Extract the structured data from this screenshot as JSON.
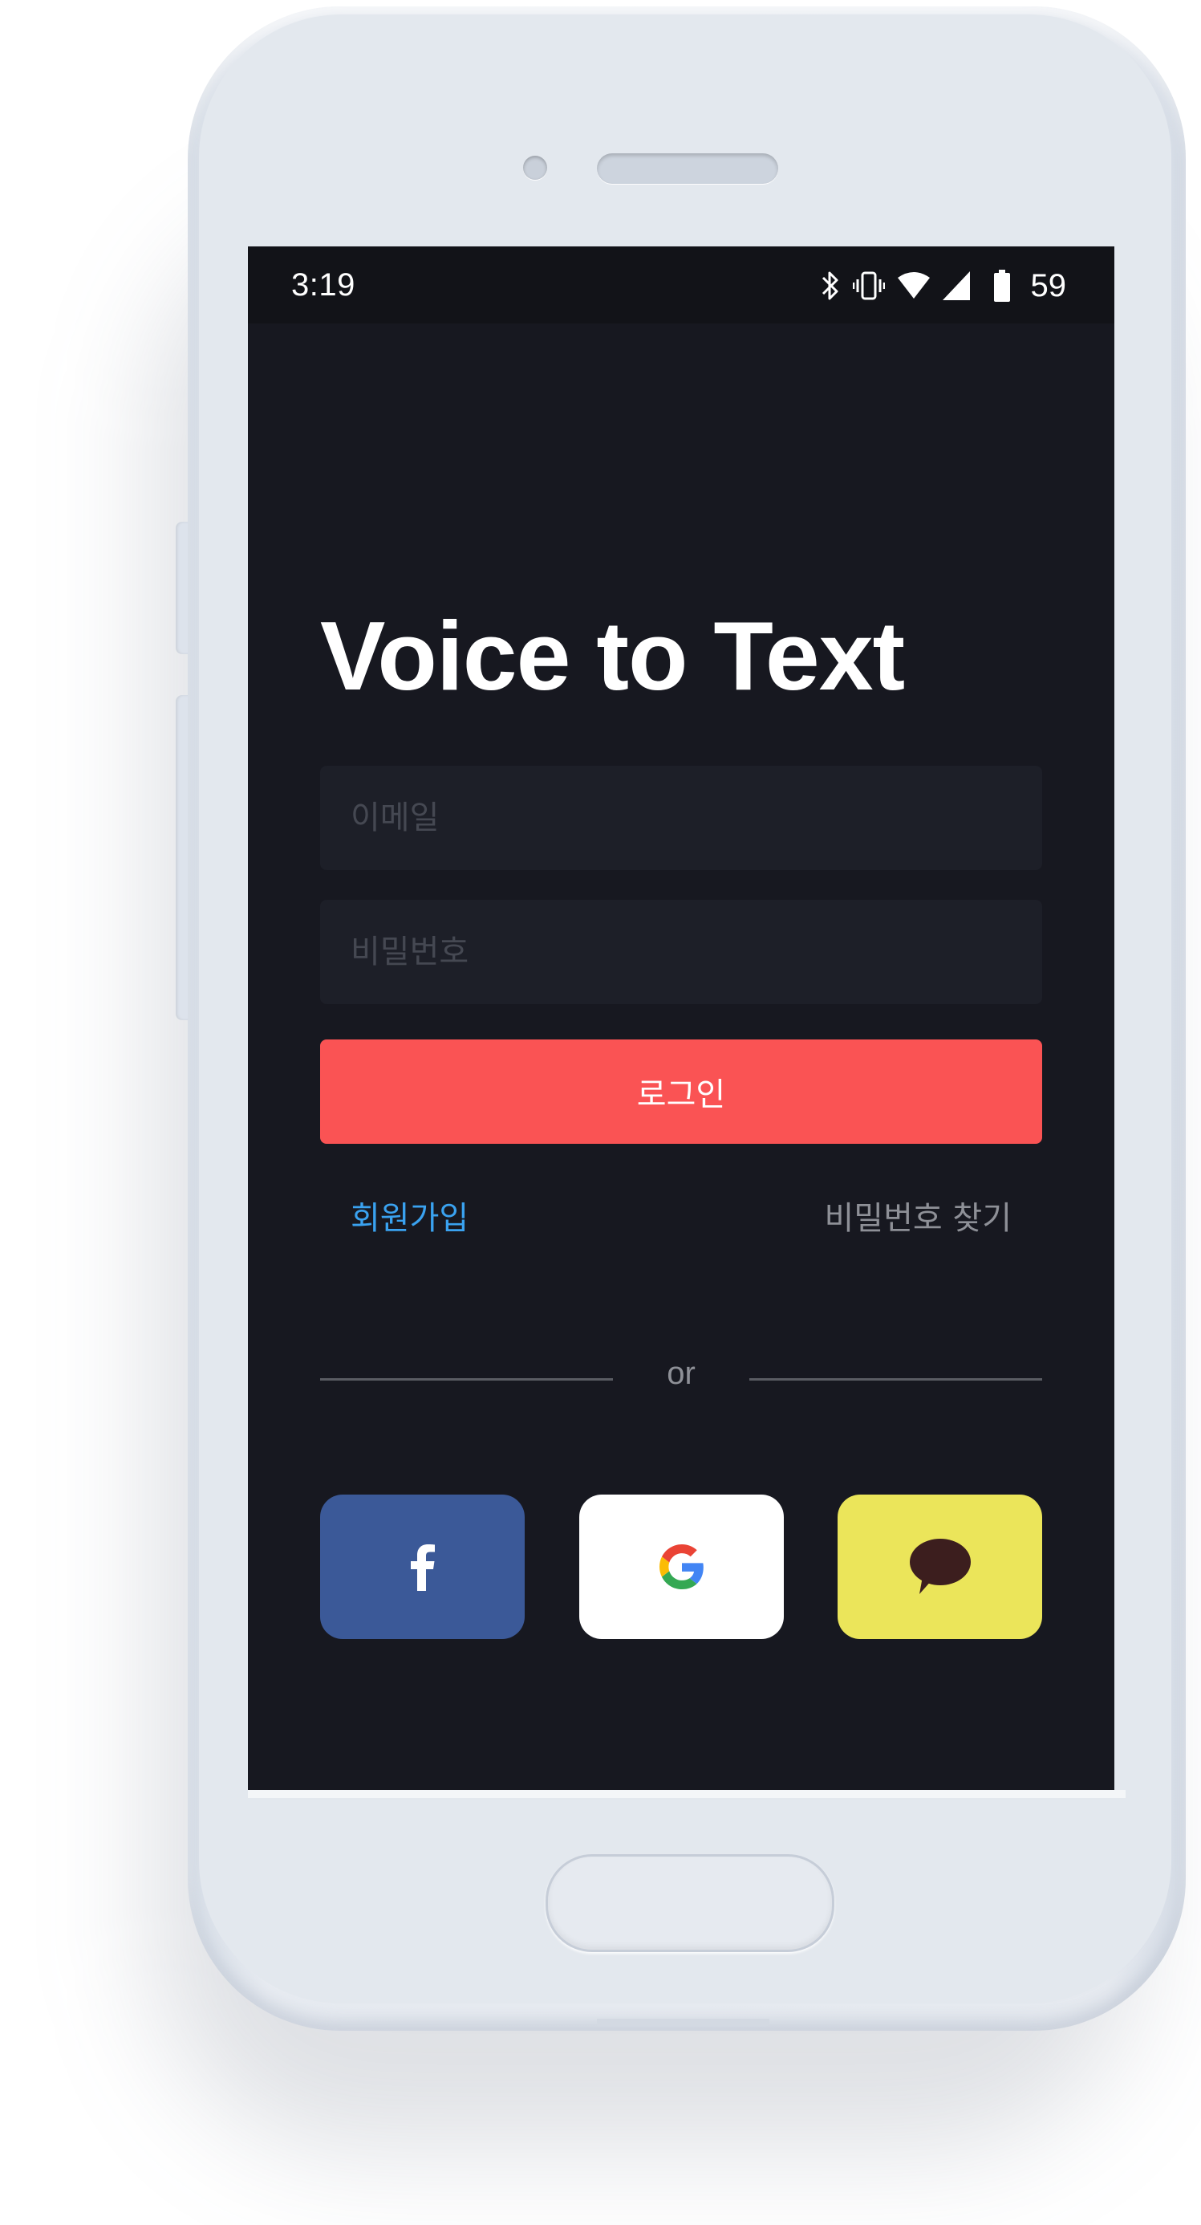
{
  "status_bar": {
    "time": "3:19",
    "battery_level": "59",
    "icons": [
      "bluetooth-icon",
      "vibrate-icon",
      "wifi-icon",
      "cell-signal-icon",
      "battery-icon"
    ]
  },
  "app": {
    "title": "Voice to Text"
  },
  "login_form": {
    "email_placeholder": "이메일",
    "email_value": "",
    "password_placeholder": "비밀번호",
    "password_value": "",
    "login_button_label": "로그인"
  },
  "links": {
    "signup_label": "회원가입",
    "find_password_label": "비밀번호 찾기"
  },
  "divider": {
    "label": "or"
  },
  "social_login": [
    {
      "provider": "Facebook",
      "icon": "facebook-icon",
      "color": "#3b5998"
    },
    {
      "provider": "Google",
      "icon": "google-icon",
      "color": "#ffffff"
    },
    {
      "provider": "Kakao",
      "icon": "kakao-talk-icon",
      "color": "#ebe55a"
    }
  ],
  "colors": {
    "background": "#171820",
    "input_background": "#1d1f28",
    "accent": "#fa5354",
    "link": "#3aa2f0",
    "muted_text": "#8e9097"
  }
}
